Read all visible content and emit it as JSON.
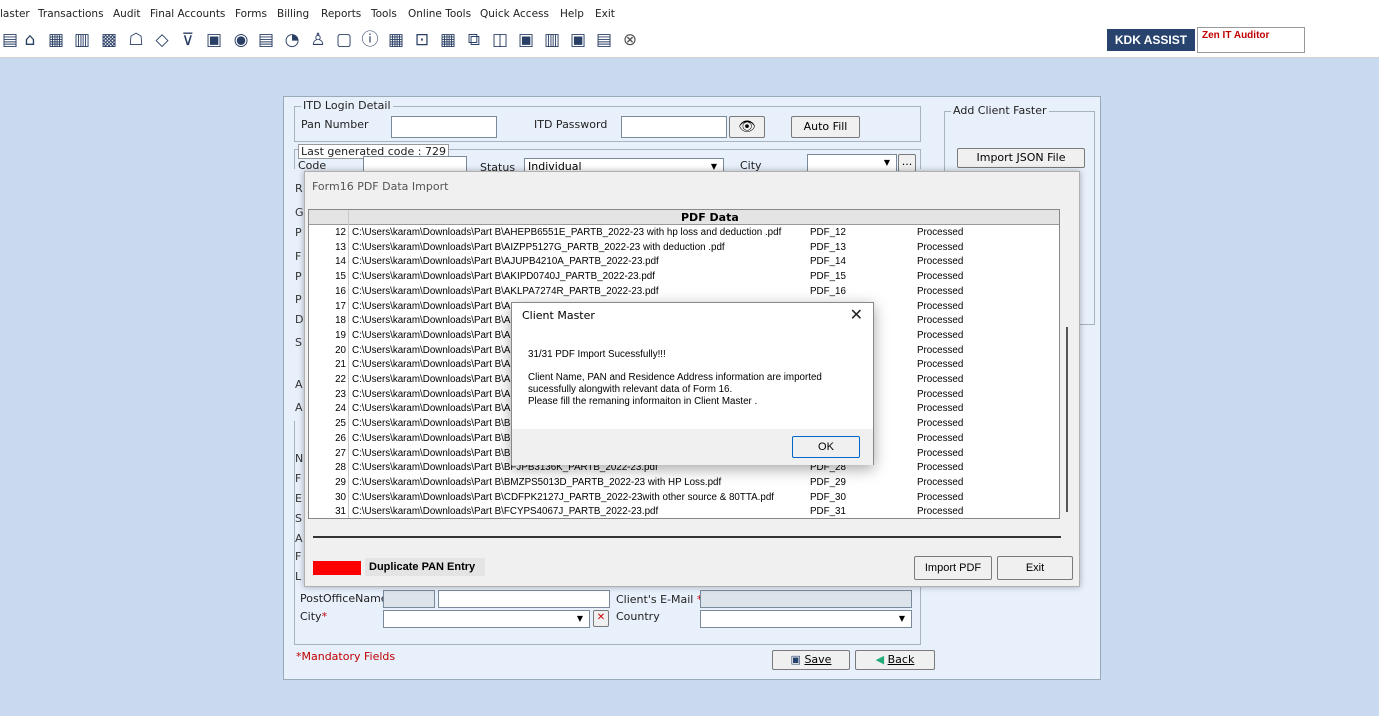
{
  "menu": [
    "laster",
    "Transactions",
    "Audit",
    "Final Accounts",
    "Forms",
    "Billing",
    "Reports",
    "Tools",
    "Online Tools",
    "Quick Access",
    "Help",
    "Exit"
  ],
  "toolbar": {
    "icons": [
      "doc-icon",
      "home-icon",
      "grid-icon",
      "chart-icon",
      "building-icon",
      "group-icon",
      "tag-icon",
      "filter-icon",
      "tax-icon",
      "refresh-icon",
      "calculator-icon",
      "pie-icon",
      "pay-icon",
      "blank-icon",
      "info-icon",
      "table-icon",
      "export-icon",
      "calendar-icon",
      "copy-icon",
      "clone-icon",
      "bs-icon",
      "ledger-icon",
      "scd-icon",
      "report-icon",
      "close-icon"
    ],
    "kdk_label": "KDK ASSIST",
    "zen_label": "Zen IT Auditor"
  },
  "client_master": {
    "itd_legend": "ITD Login Detail",
    "pan_label": "Pan Number",
    "itd_password_label": "ITD Password",
    "auto_fill_label": "Auto Fill",
    "add_client_legend": "Add Client Faster",
    "import_json_label": "Import JSON File",
    "last_generated": "Last generated code : 729",
    "code_label": "Code",
    "status_label": "Status",
    "status_value": "Individual",
    "city_label": "City",
    "city_more": "...",
    "post_office_label": "PostOfficeName",
    "email_label": "Client's E-Mail",
    "email_mandatory": "*",
    "city2_label": "City",
    "city2_mandatory": "*",
    "country_label": "Country",
    "mandatory_note": "*Mandatory Fields",
    "save_label": "Save",
    "back_label": "Back"
  },
  "left_edge_letters": [
    "R",
    "G",
    "P",
    "F",
    "P",
    "P",
    "D",
    "S",
    "A",
    "A",
    "N",
    "F",
    "E",
    "S",
    "A",
    "F",
    "L"
  ],
  "form16": {
    "title": "Form16 PDF Data Import",
    "column_header": "PDF Data",
    "rows": [
      {
        "num": "12",
        "path": "C:\\Users\\karam\\Downloads\\Part B\\AHEPB6551E_PARTB_2022-23 with hp loss and deduction .pdf",
        "code": "PDF_12",
        "status": "Processed"
      },
      {
        "num": "13",
        "path": "C:\\Users\\karam\\Downloads\\Part B\\AIZPP5127G_PARTB_2022-23 with deduction .pdf",
        "code": "PDF_13",
        "status": "Processed"
      },
      {
        "num": "14",
        "path": "C:\\Users\\karam\\Downloads\\Part B\\AJUPB4210A_PARTB_2022-23.pdf",
        "code": "PDF_14",
        "status": "Processed"
      },
      {
        "num": "15",
        "path": "C:\\Users\\karam\\Downloads\\Part B\\AKIPD0740J_PARTB_2022-23.pdf",
        "code": "PDF_15",
        "status": "Processed"
      },
      {
        "num": "16",
        "path": "C:\\Users\\karam\\Downloads\\Part B\\AKLPA7274R_PARTB_2022-23.pdf",
        "code": "PDF_16",
        "status": "Processed"
      },
      {
        "num": "17",
        "path": "C:\\Users\\karam\\Downloads\\Part B\\AL",
        "code": "",
        "status": "Processed"
      },
      {
        "num": "18",
        "path": "C:\\Users\\karam\\Downloads\\Part B\\AI",
        "code": "",
        "status": "Processed"
      },
      {
        "num": "19",
        "path": "C:\\Users\\karam\\Downloads\\Part B\\AI",
        "code": "",
        "status": "Processed"
      },
      {
        "num": "20",
        "path": "C:\\Users\\karam\\Downloads\\Part B\\A",
        "code": "",
        "status": "Processed"
      },
      {
        "num": "21",
        "path": "C:\\Users\\karam\\Downloads\\Part B\\A",
        "code": "",
        "status": "Processed"
      },
      {
        "num": "22",
        "path": "C:\\Users\\karam\\Downloads\\Part B\\A",
        "code": "",
        "status": "Processed"
      },
      {
        "num": "23",
        "path": "C:\\Users\\karam\\Downloads\\Part B\\A",
        "code": "",
        "status": "Processed"
      },
      {
        "num": "24",
        "path": "C:\\Users\\karam\\Downloads\\Part B\\A",
        "code": "",
        "status": "Processed"
      },
      {
        "num": "25",
        "path": "C:\\Users\\karam\\Downloads\\Part B\\BI",
        "code": "",
        "status": "Processed"
      },
      {
        "num": "26",
        "path": "C:\\Users\\karam\\Downloads\\Part B\\BI",
        "code": "",
        "status": "Processed"
      },
      {
        "num": "27",
        "path": "C:\\Users\\karam\\Downloads\\Part B\\BI",
        "code": "",
        "status": "Processed"
      },
      {
        "num": "28",
        "path": "C:\\Users\\karam\\Downloads\\Part B\\BFJPB3136K_PARTB_2022-23.pdf",
        "code": "PDF_28",
        "status": "Processed"
      },
      {
        "num": "29",
        "path": "C:\\Users\\karam\\Downloads\\Part B\\BMZPS5013D_PARTB_2022-23 with HP Loss.pdf",
        "code": "PDF_29",
        "status": "Processed"
      },
      {
        "num": "30",
        "path": "C:\\Users\\karam\\Downloads\\Part B\\CDFPK2127J_PARTB_2022-23with other source & 80TTA.pdf",
        "code": "PDF_30",
        "status": "Processed"
      },
      {
        "num": "31",
        "path": "C:\\Users\\karam\\Downloads\\Part B\\FCYPS4067J_PARTB_2022-23.pdf",
        "code": "PDF_31",
        "status": "Processed"
      }
    ],
    "duplicate_label": "Duplicate PAN Entry",
    "import_pdf_label": "Import PDF",
    "exit_label": "Exit",
    "duplicate_color": "#ff0000"
  },
  "dialog": {
    "title": "Client Master",
    "close_glyph": "✕",
    "line1": "31/31 PDF Import Sucessfully!!!",
    "line2": "Client Name, PAN and Residence Address information are imported",
    "line3": "sucessfully alongwith relevant data of Form 16.",
    "line4": "Please fill the remaning informaiton in Client Master .",
    "ok_label": "OK"
  }
}
